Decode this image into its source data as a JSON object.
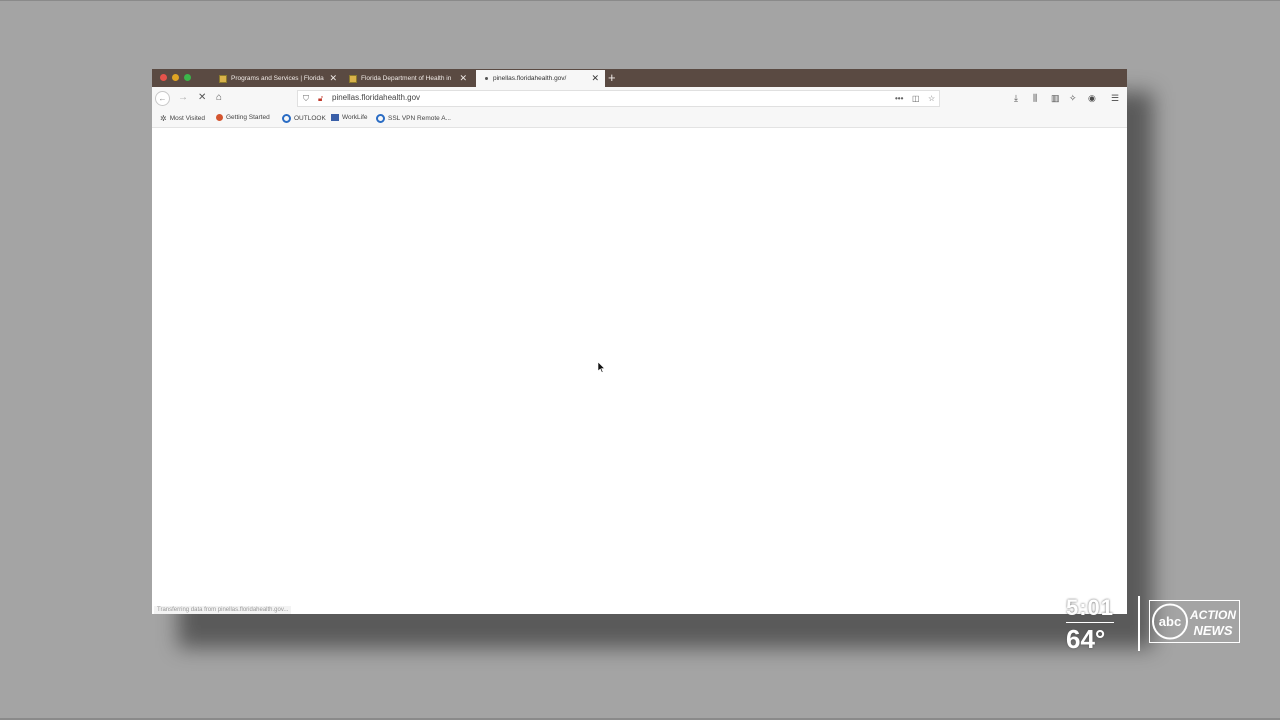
{
  "browser": {
    "tabs": [
      {
        "label": "Programs and Services | Florida"
      },
      {
        "label": "Florida Department of Health in"
      },
      {
        "label": "pinellas.floridahealth.gov/"
      }
    ],
    "new_tab_icon": "plus-icon",
    "url": "pinellas.floridahealth.gov",
    "bookmarks": [
      {
        "label": "Most Visited",
        "icon": "gear-icon"
      },
      {
        "label": "Getting Started",
        "icon": "firefox-icon"
      },
      {
        "label": "OUTLOOK",
        "icon": "ring-icon"
      },
      {
        "label": "WorkLife",
        "icon": "worklife-icon"
      },
      {
        "label": "SSL VPN Remote A...",
        "icon": "ring-icon"
      }
    ],
    "status_text": "Transferring data from pinellas.floridahealth.gov..."
  },
  "overlay": {
    "time": "5:01",
    "temperature": "64°",
    "logo_text": "abc ACTION NEWS"
  },
  "colors": {
    "tabstrip": "#5a4a42",
    "background": "#a4a4a4"
  }
}
